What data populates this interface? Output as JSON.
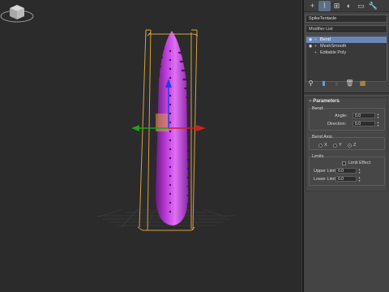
{
  "command_panel": {
    "tabs": [
      {
        "name": "create",
        "glyph": "+"
      },
      {
        "name": "modify",
        "glyph": "⌇"
      },
      {
        "name": "hierarchy",
        "glyph": "⊞"
      },
      {
        "name": "motion",
        "glyph": "◐"
      },
      {
        "name": "display",
        "glyph": "▭"
      },
      {
        "name": "utilities",
        "glyph": "🔧"
      }
    ],
    "active_tab": "modify",
    "object_name": "SpikeTentacle",
    "modifier_list_label": "Modifier List",
    "stack": [
      {
        "label": "Bend",
        "selected": true,
        "eye": true,
        "expand": "+"
      },
      {
        "label": "MeshSmooth",
        "selected": false,
        "eye": true,
        "expand": "+"
      },
      {
        "label": "Editable Poly",
        "selected": false,
        "eye": false,
        "expand": "+"
      }
    ],
    "accent_color": "#6a86b6"
  },
  "parameters": {
    "title": "Parameters",
    "collapse_glyph": "−",
    "bend_label": "Bend:",
    "angle_label": "Angle:",
    "angle_value": "0.0",
    "direction_label": "Direction:",
    "direction_value": "0.0",
    "bend_axis_label": "Bend Axis:",
    "axes": [
      {
        "label": "X",
        "selected": false
      },
      {
        "label": "Y",
        "selected": false
      },
      {
        "label": "Z",
        "selected": true
      }
    ],
    "limits_label": "Limits",
    "limit_effect_label": "Limit Effect",
    "limit_effect_checked": false,
    "upper_limit_label": "Upper Limit:",
    "upper_limit_value": "0.0",
    "lower_limit_label": "Lower Limit:",
    "lower_limit_value": "0.0"
  },
  "viewport": {
    "object_color": "#c837e0",
    "gizmo_x_color": "#d02020",
    "gizmo_y_color": "#20a020",
    "gizmo_z_color": "#2040e0",
    "bbox_color": "#d8a040"
  }
}
